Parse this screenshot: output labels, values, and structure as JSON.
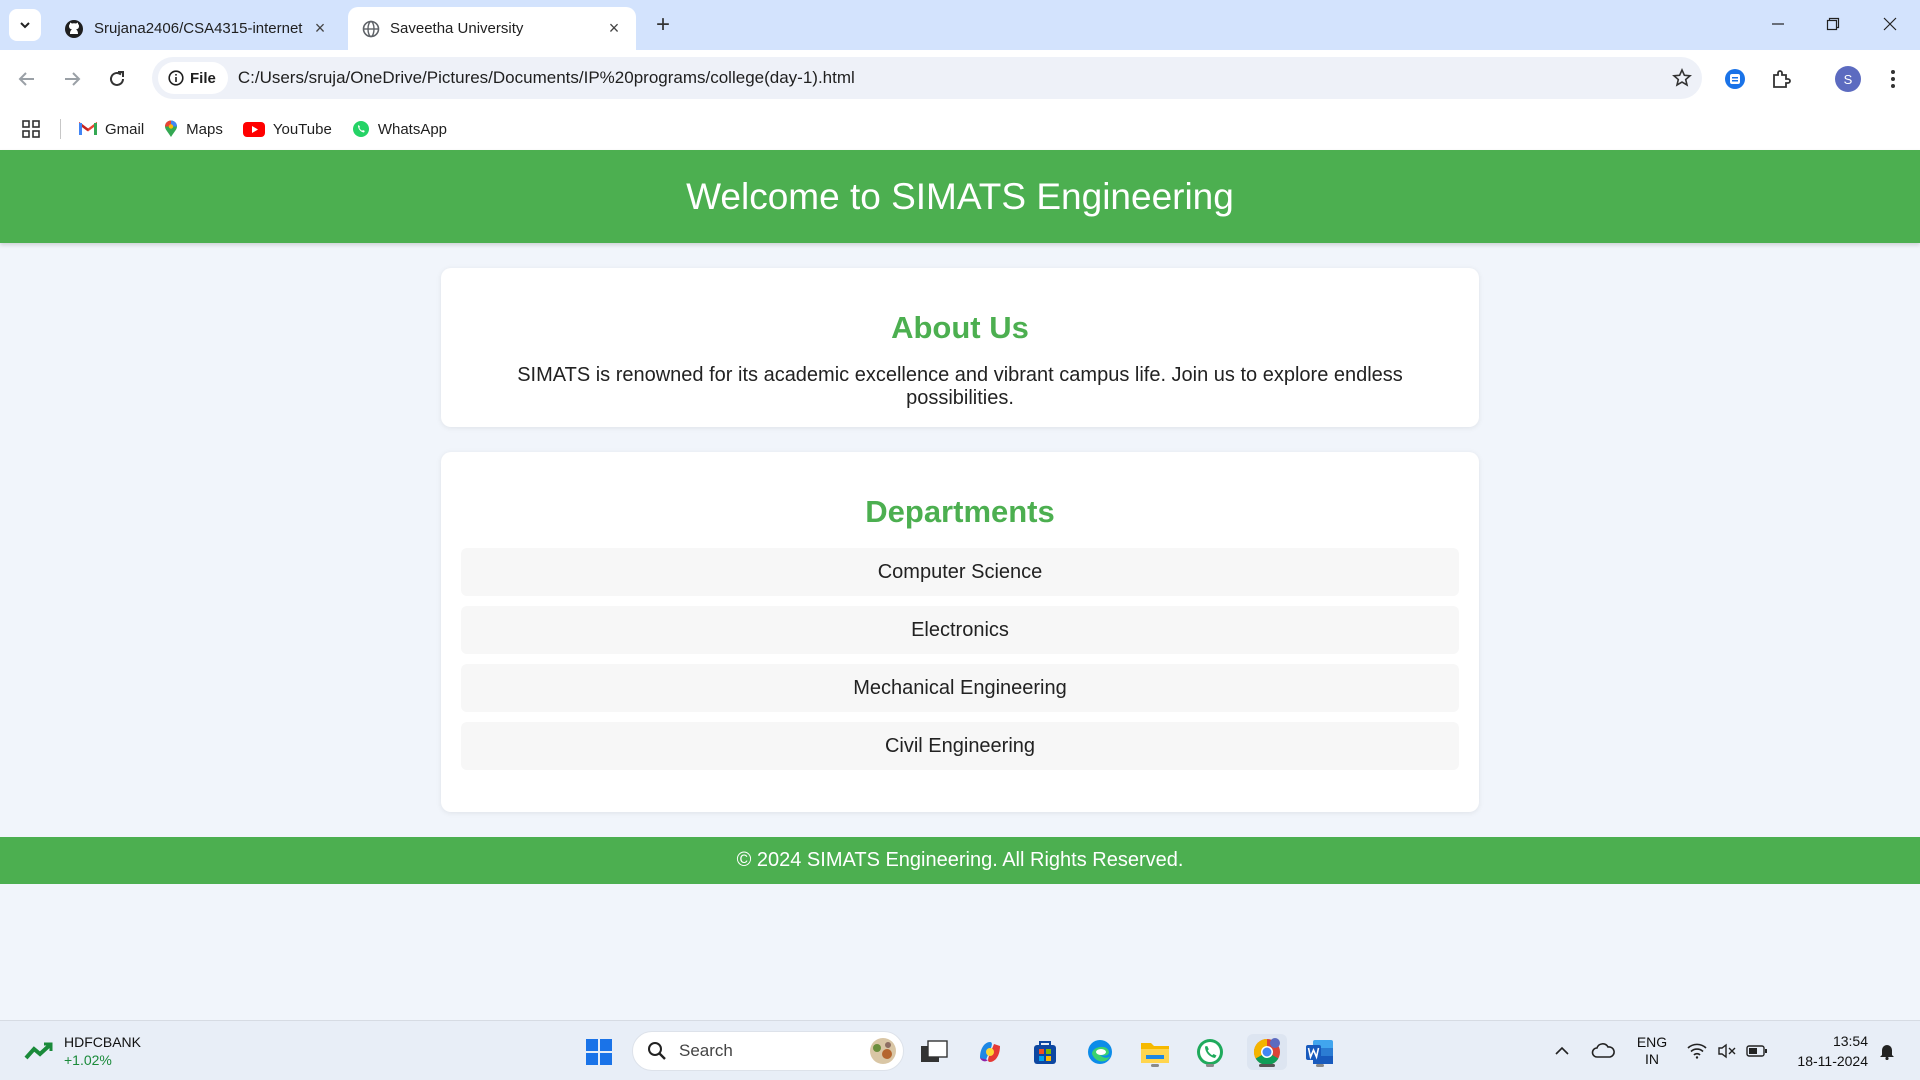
{
  "browser": {
    "tabs": [
      {
        "title": "Srujana2406/CSA4315-internet",
        "icon": "github-icon",
        "active": false
      },
      {
        "title": "Saveetha University",
        "icon": "globe-icon",
        "active": true
      }
    ],
    "address": {
      "chip_label": "File",
      "url": "C:/Users/sruja/OneDrive/Pictures/Documents/IP%20programs/college(day-1).html"
    },
    "profile_initial": "S",
    "bookmarks": [
      {
        "label": "Gmail",
        "icon": "gmail-icon"
      },
      {
        "label": "Maps",
        "icon": "maps-icon"
      },
      {
        "label": "YouTube",
        "icon": "youtube-icon"
      },
      {
        "label": "WhatsApp",
        "icon": "whatsapp-icon"
      }
    ]
  },
  "page": {
    "header_title": "Welcome to SIMATS Engineering",
    "about": {
      "heading": "About Us",
      "text": "SIMATS is renowned for its academic excellence and vibrant campus life. Join us to explore endless possibilities."
    },
    "departments": {
      "heading": "Departments",
      "items": [
        "Computer Science",
        "Electronics",
        "Mechanical Engineering",
        "Civil Engineering"
      ]
    },
    "footer_text": "© 2024 SIMATS Engineering. All Rights Reserved."
  },
  "taskbar": {
    "stock": {
      "symbol": "HDFCBANK",
      "change": "+1.02%"
    },
    "search_placeholder": "Search",
    "tray": {
      "lang_top": "ENG",
      "lang_bottom": "IN"
    },
    "time": "13:54",
    "date": "18-11-2024"
  },
  "colors": {
    "accent": "#4caf50",
    "page_bg": "#f1f5fb",
    "tabbar_bg": "#d3e3fd"
  }
}
